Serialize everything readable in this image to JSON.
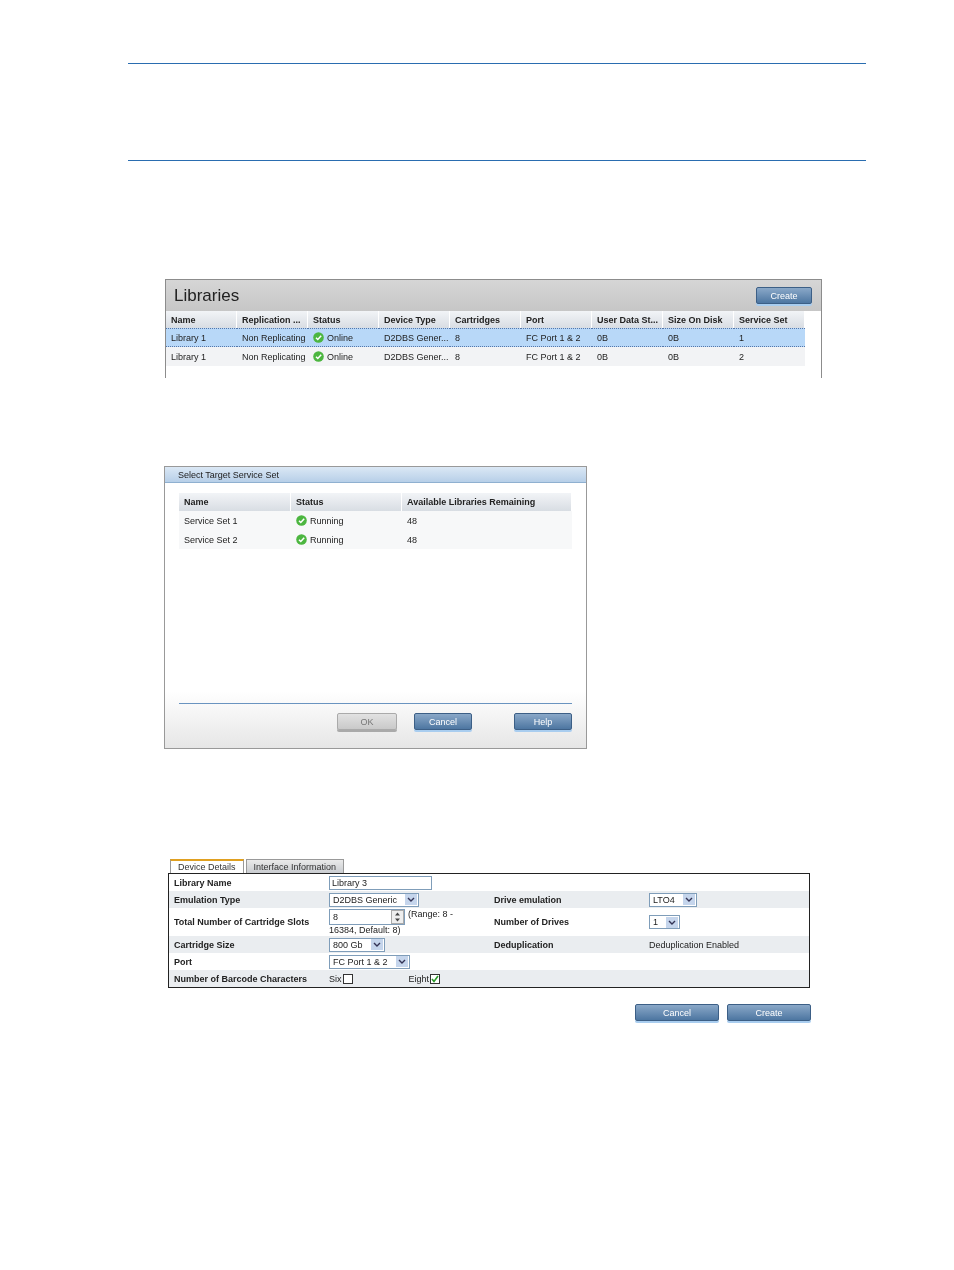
{
  "libraries": {
    "title": "Libraries",
    "create_button": "Create",
    "columns": [
      "Name",
      "Replication ...",
      "Status",
      "Device Type",
      "Cartridges",
      "Port",
      "User Data St...",
      "Size On Disk",
      "Service Set"
    ],
    "rows": [
      {
        "selected": true,
        "name": "Library 1",
        "replication": "Non Replicating",
        "status": "Online",
        "device_type": "D2DBS Gener...",
        "cartridges": "8",
        "port": "FC Port 1 & 2",
        "user_data": "0B",
        "size_on_disk": "0B",
        "service_set": "1"
      },
      {
        "selected": false,
        "name": "Library 1",
        "replication": "Non Replicating",
        "status": "Online",
        "device_type": "D2DBS Gener...",
        "cartridges": "8",
        "port": "FC Port 1 & 2",
        "user_data": "0B",
        "size_on_disk": "0B",
        "service_set": "2"
      }
    ]
  },
  "service_set_dialog": {
    "title": "Select Target Service Set",
    "columns": [
      "Name",
      "Status",
      "Available Libraries Remaining"
    ],
    "rows": [
      {
        "name": "Service Set 1",
        "status": "Running",
        "remaining": "48"
      },
      {
        "name": "Service Set 2",
        "status": "Running",
        "remaining": "48"
      }
    ],
    "buttons": [
      {
        "label": "OK",
        "disabled": true
      },
      {
        "label": "Cancel",
        "disabled": false
      },
      {
        "label": "Help",
        "disabled": false
      }
    ]
  },
  "library_form": {
    "tabs": [
      {
        "label": "Device Details",
        "selected": true
      },
      {
        "label": "Interface Information",
        "selected": false
      }
    ],
    "rows": [
      {
        "label": "Library Name",
        "field": {
          "kind": "text",
          "value": "Library 3"
        }
      },
      {
        "label": "Emulation Type",
        "field": {
          "kind": "select",
          "value": "D2DBS Generic"
        },
        "right_label": "Drive emulation",
        "right_field": {
          "kind": "select",
          "value": "LTO4"
        }
      },
      {
        "label": "Total Number of Cartridge Slots",
        "field": {
          "kind": "spinner",
          "value": "8",
          "note": "(Range: 8 -",
          "note_continued": "16384, Default: 8)"
        },
        "right_label": "Number of Drives",
        "right_field": {
          "kind": "select",
          "value": "1"
        }
      },
      {
        "label": "Cartridge Size",
        "field": {
          "kind": "select",
          "value": "800 Gb"
        },
        "right_label": "Deduplication",
        "right_field": {
          "kind": "static",
          "value": "Deduplication Enabled"
        }
      },
      {
        "label": "Port",
        "field": {
          "kind": "select",
          "value": "FC Port 1 & 2"
        }
      },
      {
        "label": "Number of Barcode Characters",
        "field": {
          "kind": "checkboxes",
          "options": [
            {
              "label": "Six",
              "checked": false
            },
            {
              "label": "Eight",
              "checked": true
            }
          ]
        }
      }
    ],
    "buttons": [
      "Cancel",
      "Create"
    ]
  }
}
